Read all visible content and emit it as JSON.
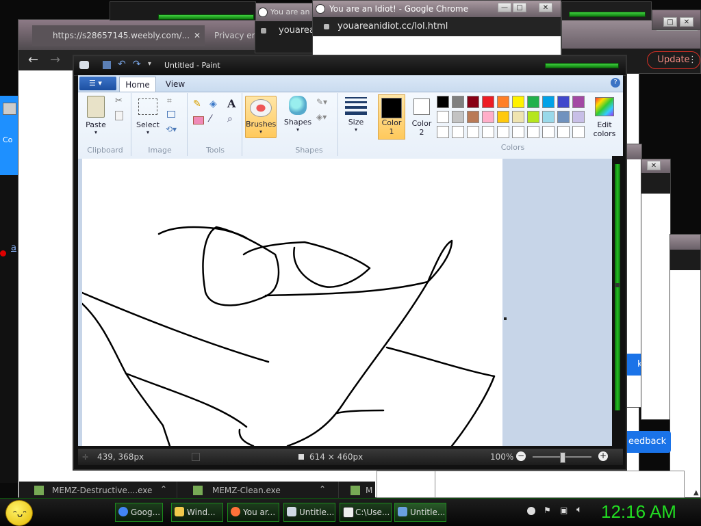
{
  "chrome_back": {
    "tab1_url": "https://s28657145.weebly.com/...",
    "tab2_label": "Privacy error",
    "tab3_label": "You are an",
    "tab3_url": "youarea",
    "update_label": "Update",
    "desktop_icon_label": "Co",
    "side_link": "a"
  },
  "chrome_front": {
    "title": "You are an Idiot! - Google Chrome",
    "url": "youareanidiot.cc/lol.html"
  },
  "paint": {
    "title": "Untitled - Paint",
    "tabs": [
      "Home",
      "View"
    ],
    "groups": {
      "clipboard": "Clipboard",
      "image": "Image",
      "tools": "Tools",
      "shapes": "Shapes",
      "colors": "Colors"
    },
    "buttons": {
      "paste": "Paste",
      "select": "Select",
      "brushes": "Brushes",
      "shapes": "Shapes",
      "size": "Size",
      "color1_a": "Color",
      "color1_b": "1",
      "color2_a": "Color",
      "color2_b": "2",
      "edit_a": "Edit",
      "edit_b": "colors"
    },
    "palette_row1": [
      "#000000",
      "#7f7f7f",
      "#880015",
      "#ed1c24",
      "#ff7f27",
      "#fff200",
      "#22b14c",
      "#00a2e8",
      "#3f48cc",
      "#a349a4"
    ],
    "palette_row2": [
      "#ffffff",
      "#c3c3c3",
      "#b97a57",
      "#ffaec9",
      "#ffc90e",
      "#efe4b0",
      "#b5e61d",
      "#99d9ea",
      "#7092be",
      "#c8bfe7"
    ],
    "status": {
      "cursor": "439, 368px",
      "size": "614 × 460px",
      "zoom": "100%"
    }
  },
  "right_windows": {
    "button_k": "k",
    "feedback": "eedback"
  },
  "downloads": [
    {
      "name": "MEMZ-Destructive....exe"
    },
    {
      "name": "MEMZ-Clean.exe"
    },
    {
      "name": "M"
    }
  ],
  "taskbar": {
    "items": [
      {
        "label": "Goog...",
        "color": "#4285f4"
      },
      {
        "label": "Wind...",
        "color": "#f2c94c"
      },
      {
        "label": "You ar...",
        "color": "#ff7139"
      },
      {
        "label": "Untitle...",
        "color": "#cfd8e3"
      },
      {
        "label": "C:\\Use...",
        "color": "#222222"
      },
      {
        "label": "Untitle...",
        "color": "#6aa0e0"
      }
    ],
    "clock": "12:16 AM"
  },
  "colors": {
    "accent_green": "#18c018",
    "update_red": "#d93025",
    "blue_button": "#1a73e8"
  }
}
